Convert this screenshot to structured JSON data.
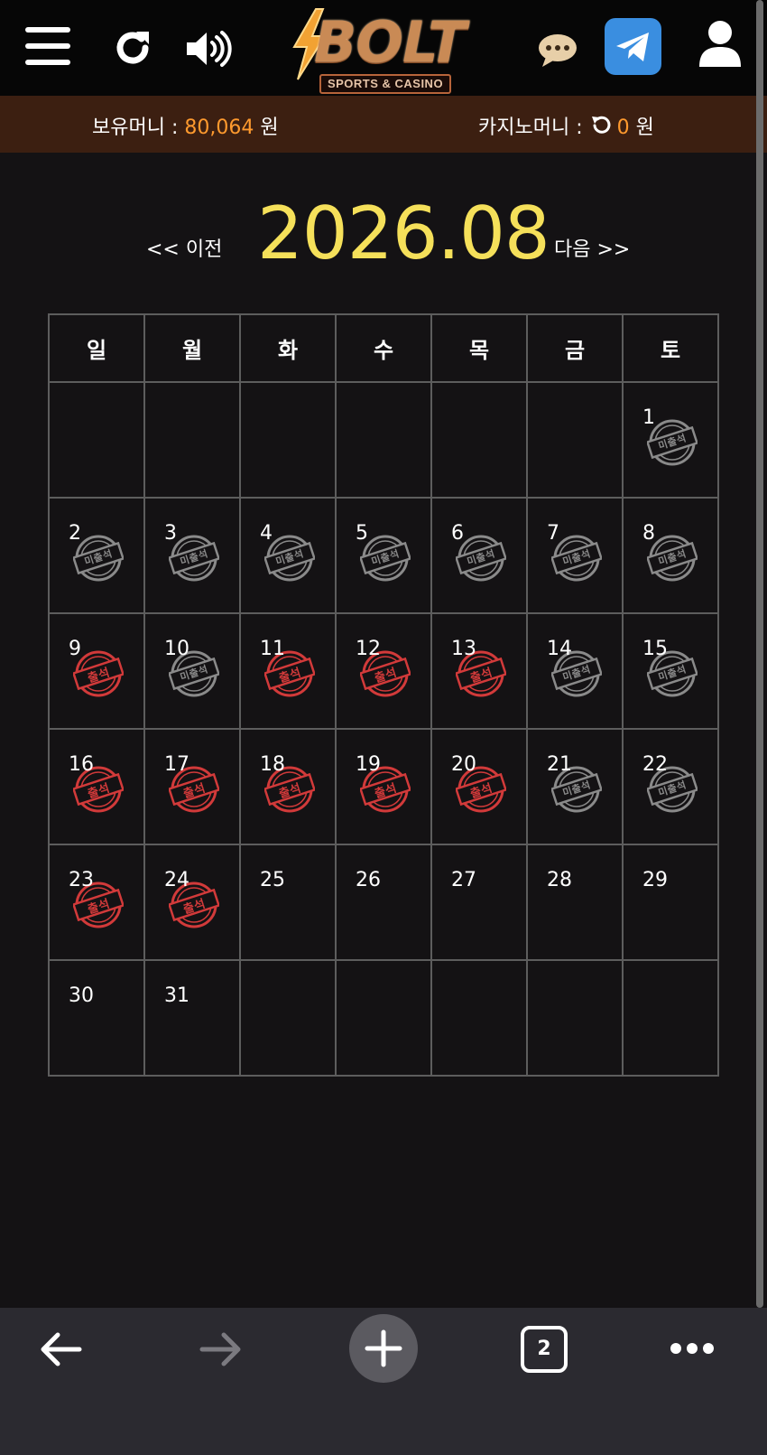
{
  "header": {
    "logo_text": "BOLT",
    "logo_subtitle": "SPORTS & CASINO",
    "icons": [
      "menu-icon",
      "refresh-icon",
      "sound-icon",
      "chat-icon",
      "telegram-icon",
      "user-icon"
    ]
  },
  "balance": {
    "money_label": "보유머니 :",
    "money_value": "80,064",
    "money_unit": "원",
    "casino_label": "카지노머니 :",
    "casino_value": "0",
    "casino_unit": "원"
  },
  "calendar": {
    "prev_label": "<< 이전",
    "month_label": "2026.08",
    "next_label": "다음 >>",
    "weekdays": [
      "일",
      "월",
      "화",
      "수",
      "목",
      "금",
      "토"
    ],
    "stamp_present": "출석",
    "stamp_absent": "미출석",
    "weeks": [
      [
        {
          "day": ""
        },
        {
          "day": ""
        },
        {
          "day": ""
        },
        {
          "day": ""
        },
        {
          "day": ""
        },
        {
          "day": ""
        },
        {
          "day": "1",
          "status": "absent"
        }
      ],
      [
        {
          "day": "2",
          "status": "absent"
        },
        {
          "day": "3",
          "status": "absent"
        },
        {
          "day": "4",
          "status": "absent"
        },
        {
          "day": "5",
          "status": "absent"
        },
        {
          "day": "6",
          "status": "absent"
        },
        {
          "day": "7",
          "status": "absent"
        },
        {
          "day": "8",
          "status": "absent"
        }
      ],
      [
        {
          "day": "9",
          "status": "present"
        },
        {
          "day": "10",
          "status": "absent"
        },
        {
          "day": "11",
          "status": "present"
        },
        {
          "day": "12",
          "status": "present"
        },
        {
          "day": "13",
          "status": "present"
        },
        {
          "day": "14",
          "status": "absent"
        },
        {
          "day": "15",
          "status": "absent"
        }
      ],
      [
        {
          "day": "16",
          "status": "present"
        },
        {
          "day": "17",
          "status": "present"
        },
        {
          "day": "18",
          "status": "present"
        },
        {
          "day": "19",
          "status": "present"
        },
        {
          "day": "20",
          "status": "present"
        },
        {
          "day": "21",
          "status": "absent"
        },
        {
          "day": "22",
          "status": "absent"
        }
      ],
      [
        {
          "day": "23",
          "status": "present"
        },
        {
          "day": "24",
          "status": "present"
        },
        {
          "day": "25"
        },
        {
          "day": "26"
        },
        {
          "day": "27"
        },
        {
          "day": "28"
        },
        {
          "day": "29"
        }
      ],
      [
        {
          "day": "30"
        },
        {
          "day": "31"
        },
        {
          "day": ""
        },
        {
          "day": ""
        },
        {
          "day": ""
        },
        {
          "day": ""
        },
        {
          "day": ""
        }
      ]
    ]
  },
  "browser": {
    "tab_count": "2",
    "icons": [
      "back-arrow-icon",
      "forward-arrow-icon",
      "new-tab-icon",
      "tabs-icon",
      "more-icon"
    ]
  },
  "colors": {
    "accent_orange": "#ff9a2e",
    "month_yellow": "#f5e05a",
    "stamp_red": "#d23a3a",
    "stamp_gray": "#8a8a8a"
  }
}
